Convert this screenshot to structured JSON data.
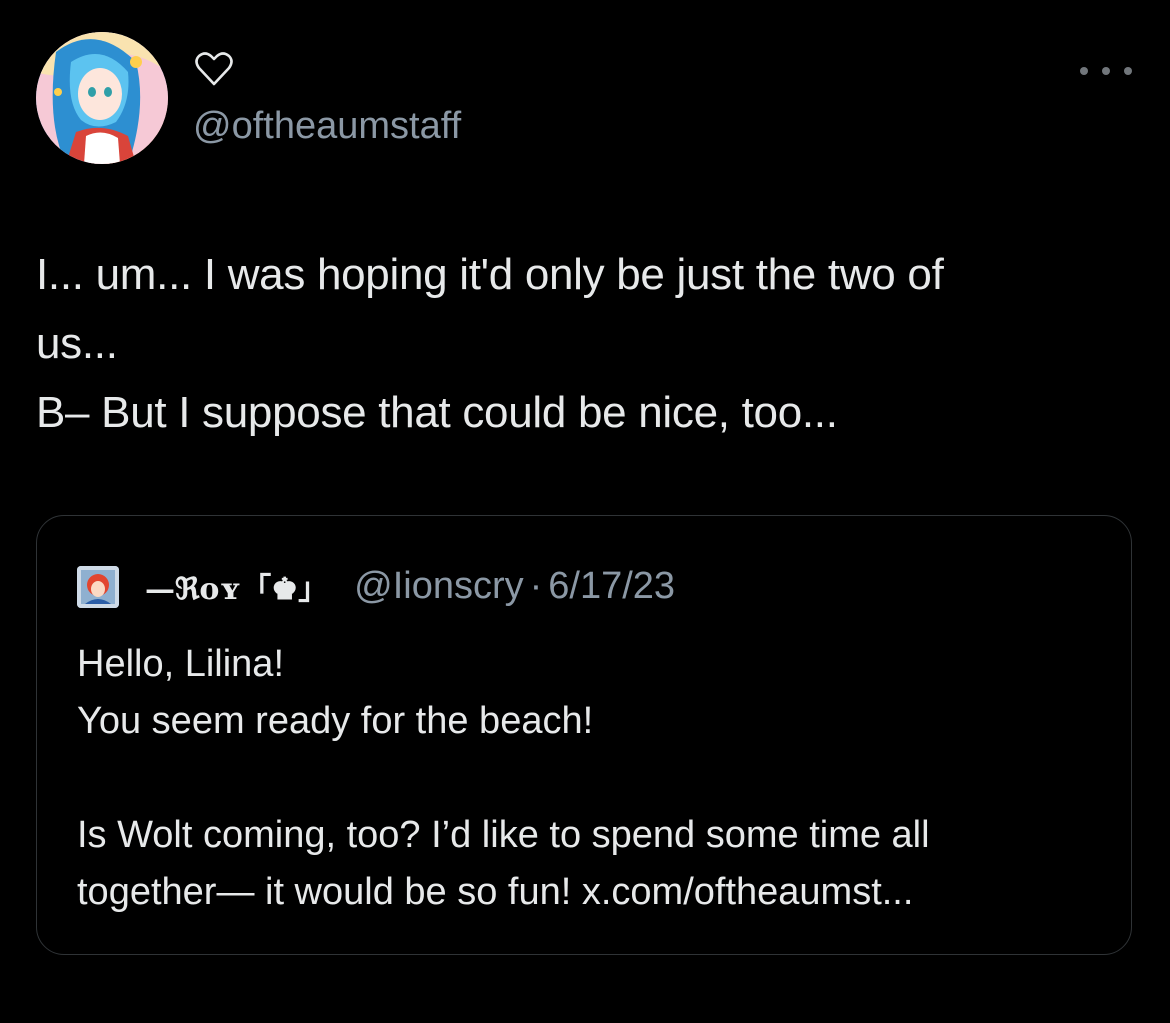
{
  "author": {
    "display_name_icon": "heart-outline-icon",
    "handle": "@oftheaumstaff",
    "avatar": "anime-character-avatar"
  },
  "menu": {
    "more_icon": "more-horizontal-icon"
  },
  "post": {
    "lines": [
      "I... um... I was hoping it'd only be just the two of",
      "us...",
      "B– But I suppose that could be nice, too..."
    ]
  },
  "quoted_post": {
    "avatar": "red-haired-character-avatar",
    "display_name": "—ℜoʏ「♚」",
    "handle": "@Iionscry",
    "separator": "·",
    "date": "6/17/23",
    "lines": [
      "Hello, Lilina!",
      "You seem ready for the beach!",
      "",
      "Is Wolt coming, too? I’d like to spend some time all",
      "together— it would be so fun! x.com/oftheaumst..."
    ]
  },
  "colors": {
    "background": "#000000",
    "text_primary": "#e7e9ea",
    "text_secondary": "#8b98a5",
    "border": "#2f3336"
  }
}
